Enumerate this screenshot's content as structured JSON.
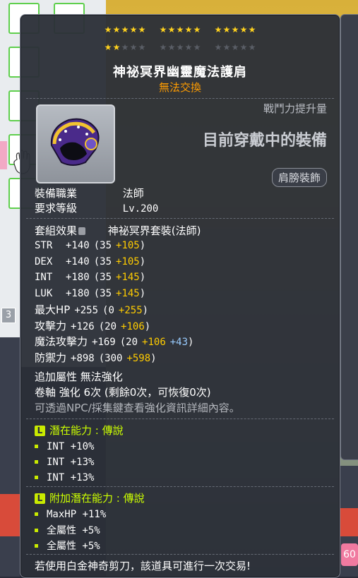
{
  "background": {
    "slot_badge_number": "3",
    "right_badge_number": "60"
  },
  "tooltip": {
    "stars": {
      "filled": 17,
      "total": 30
    },
    "title": "神祕冥界幽靈魔法護肩",
    "untradeable": "無法交換",
    "power_label": "戰鬥力提升量",
    "currently_wearing": "目前穿戴中的裝備",
    "slot_type": "肩膀裝飾",
    "req_job_label": "裝備職業",
    "req_job_value": "法師",
    "req_level_label": "要求等級",
    "req_level_value": "Lv.200",
    "set_label": "套組效果",
    "set_value": "神祕冥界套裝(法師)",
    "stats": [
      {
        "name": "STR",
        "total": "+140",
        "base": "(35",
        "bonus": "+105",
        "close": ")"
      },
      {
        "name": "DEX",
        "total": "+140",
        "base": "(35",
        "bonus": "+105",
        "close": ")"
      },
      {
        "name": "INT",
        "total": "+180",
        "base": "(35",
        "bonus": "+145",
        "close": ")"
      },
      {
        "name": "LUK",
        "total": "+180",
        "base": "(35",
        "bonus": "+145",
        "close": ")"
      },
      {
        "name": "最大HP",
        "total": "+255",
        "base": "(0",
        "bonus": "+255",
        "close": ")"
      },
      {
        "name": "攻擊力",
        "total": "+126",
        "base": "(20",
        "bonus": "+106",
        "close": ")"
      },
      {
        "name": "魔法攻擊力",
        "total": "+169",
        "base": "(20",
        "bonus": "+106",
        "extra": "+43",
        "close": ")"
      },
      {
        "name": "防禦力",
        "total": "+898",
        "base": "(300",
        "bonus": "+598",
        "close": ")"
      }
    ],
    "extra_attr": "追加屬性 無法強化",
    "scroll_line": "卷軸 強化 6次 (剩餘0次，可恢復0次)",
    "npc_hint": "可透過NPC/採集鍵查看強化資訊詳細內容。",
    "potential_title": "潛在能力 : 傳說",
    "potential_badge": "L",
    "potential": [
      "INT +10%",
      "INT +13%",
      "INT +13%"
    ],
    "bonus_potential_title": "附加潛在能力 : 傳說",
    "bonus_potential_badge": "L",
    "bonus_potential": [
      "MaxHP +11%",
      "全屬性 +5%",
      "全屬性 +5%"
    ],
    "footer": "若使用白金神奇剪刀，該道具可進行一次交易!"
  },
  "colors": {
    "star_on": "#ffd21e",
    "star_off": "#5a5e66",
    "bonus_yellow": "#ffcc00",
    "bonus_blue": "#99ccff",
    "untradeable": "#ff9c00",
    "potential_green": "#ccff00"
  }
}
